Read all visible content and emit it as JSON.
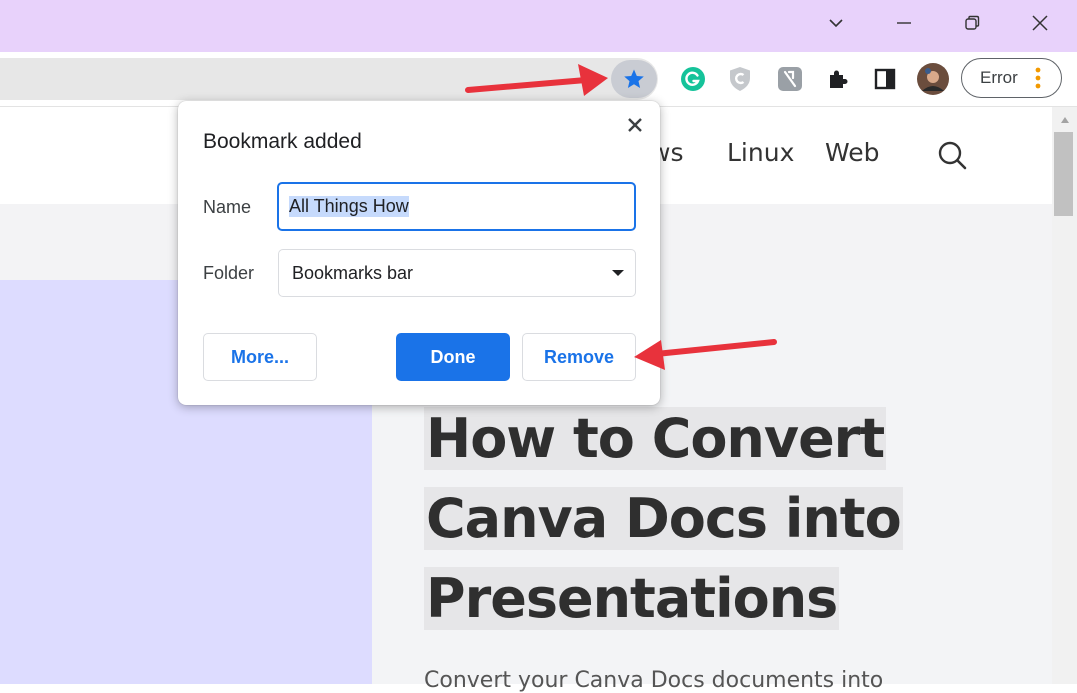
{
  "browser": {
    "window_controls": [
      "tab-search",
      "minimize",
      "restore",
      "close"
    ],
    "profile_label": "Error",
    "extensions": [
      "grammarly-icon",
      "shield-extension-icon",
      "puzzle-tool-icon",
      "extensions-icon",
      "side-panel-icon"
    ]
  },
  "site_nav": {
    "items": [
      "ws",
      "Linux",
      "Web"
    ],
    "search_icon": "search-icon"
  },
  "article": {
    "headline_lines": [
      "How to Convert",
      "Canva Docs into",
      "Presentations"
    ],
    "description": "Convert your Canva Docs documents into"
  },
  "dialog": {
    "title": "Bookmark added",
    "name_label": "Name",
    "name_value": "All Things How",
    "folder_label": "Folder",
    "folder_value": "Bookmarks bar",
    "more_label": "More...",
    "done_label": "Done",
    "remove_label": "Remove"
  },
  "colors": {
    "titlebar": "#e8d2fb",
    "accent": "#1a73e8",
    "annotation_arrow": "#e8323c",
    "left_panel": "#dddcff"
  }
}
